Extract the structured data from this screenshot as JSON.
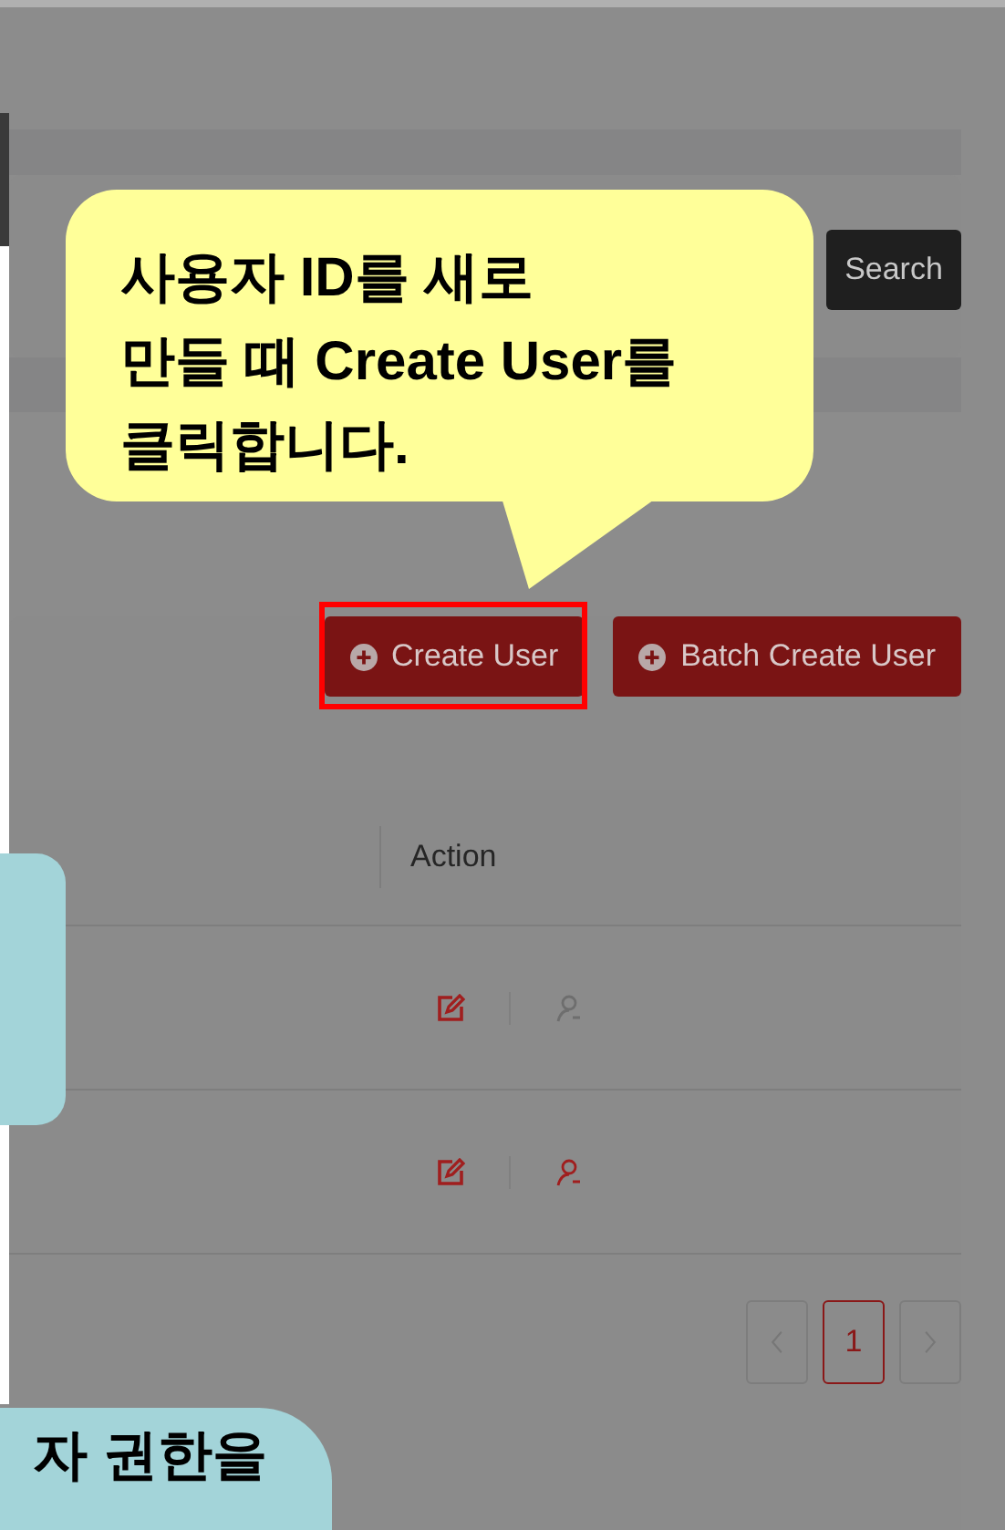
{
  "search_panel": {
    "button": "Search"
  },
  "actions": [
    {
      "label": "Create User",
      "highlighted": true
    },
    {
      "label": "Batch Create User",
      "highlighted": false
    }
  ],
  "table": {
    "columns": [
      "Action"
    ],
    "rows": [
      {
        "actions": [
          {
            "kind": "edit",
            "disabled": false
          },
          {
            "kind": "remove-user",
            "disabled": true
          }
        ]
      },
      {
        "actions": [
          {
            "kind": "edit",
            "disabled": false
          },
          {
            "kind": "remove-user",
            "disabled": false
          }
        ]
      }
    ]
  },
  "pagination": {
    "pages": [
      {
        "label": "1",
        "selected": true
      }
    ]
  },
  "callouts": [
    {
      "color": "#ffff99",
      "lines": [
        "사용자 ID를 새로",
        "만들 때 Create User를",
        "클릭합니다."
      ]
    },
    {
      "color": "#a3d4d9"
    },
    {
      "color": "#a3d4d9",
      "lines": [
        "자 권한을"
      ]
    }
  ]
}
